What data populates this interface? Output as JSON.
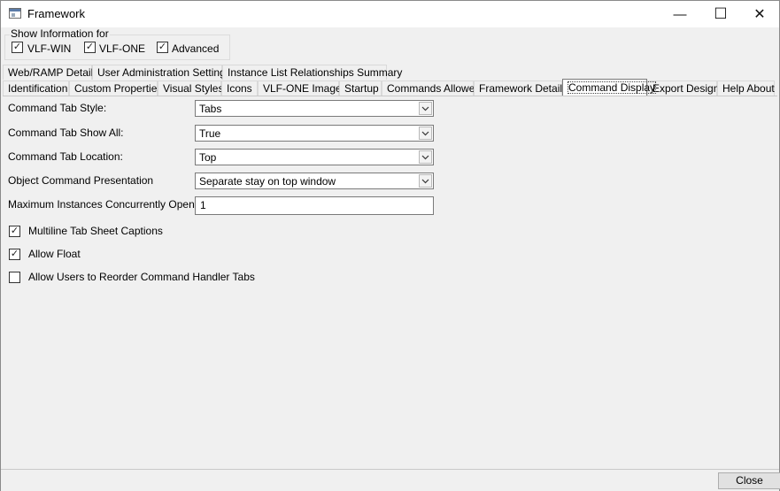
{
  "window": {
    "title": "Framework"
  },
  "title_buttons": {
    "minimize": "—",
    "maximize": "☐",
    "close": "✕"
  },
  "show_info": {
    "legend": "Show Information for",
    "options": [
      {
        "label": "VLF-WIN",
        "checked": true
      },
      {
        "label": "VLF-ONE",
        "checked": true
      },
      {
        "label": "Advanced",
        "checked": true
      }
    ]
  },
  "tabs_row1": [
    "Web/RAMP Details",
    "User Administration Settings",
    "Instance List Relationships Summary"
  ],
  "tabs_row2": [
    "Identification",
    "Custom Properties",
    "Visual Styles",
    "Icons",
    "VLF-ONE Images",
    "Startup",
    "Commands Allowed",
    "Framework Details",
    "Command Display",
    "Export Design",
    "Help About"
  ],
  "active_tab": "Command Display",
  "form": {
    "command_tab_style": {
      "label": "Command Tab Style:",
      "value": "Tabs"
    },
    "command_tab_show_all": {
      "label": "Command Tab Show All:",
      "value": "True"
    },
    "command_tab_location": {
      "label": "Command Tab Location:",
      "value": "Top"
    },
    "object_command_presentation": {
      "label": "Object Command Presentation",
      "value": "Separate stay on top window"
    },
    "maximum_instances": {
      "label": "Maximum Instances Concurrently Open",
      "value": "1"
    }
  },
  "checkboxes": {
    "multiline_tab_captions": {
      "label": "Multiline Tab Sheet Captions",
      "checked": true
    },
    "allow_float": {
      "label": "Allow Float",
      "checked": true
    },
    "allow_reorder": {
      "label": "Allow Users to Reorder Command Handler Tabs",
      "checked": false
    }
  },
  "footer": {
    "close_label": "Close"
  },
  "icons": {
    "checkmark": "✓",
    "chevron": "chevron-down-icon",
    "app": "window-app-icon"
  },
  "colors": {
    "window_bg": "#f0f0f0",
    "active_tab_bg": "#ffffff",
    "border": "#7a7a7a"
  }
}
